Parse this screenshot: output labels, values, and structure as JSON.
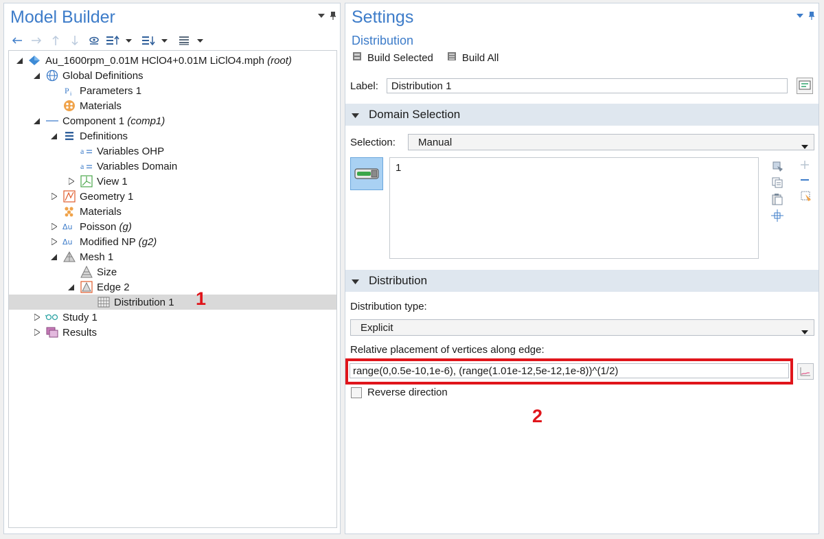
{
  "model_builder": {
    "title": "Model Builder",
    "tree": [
      {
        "label": "Au_1600rpm_0.01M HClO4+0.01M LiClO4.mph",
        "tag": "(root)",
        "icon": "model-file-icon"
      },
      {
        "label": "Global Definitions",
        "tag": "",
        "icon": "globe-icon"
      },
      {
        "label": "Parameters 1",
        "tag": "",
        "icon": "parameters-icon"
      },
      {
        "label": "Materials",
        "tag": "",
        "icon": "materials-icon"
      },
      {
        "label": "Component 1",
        "tag": "(comp1)",
        "icon": "component-icon"
      },
      {
        "label": "Definitions",
        "tag": "",
        "icon": "definitions-icon"
      },
      {
        "label": "Variables OHP",
        "tag": "",
        "icon": "variables-icon"
      },
      {
        "label": "Variables Domain",
        "tag": "",
        "icon": "variables-icon"
      },
      {
        "label": "View 1",
        "tag": "",
        "icon": "view-icon"
      },
      {
        "label": "Geometry 1",
        "tag": "",
        "icon": "geometry-icon"
      },
      {
        "label": "Materials",
        "tag": "",
        "icon": "materials-icon"
      },
      {
        "label": "Poisson",
        "tag": "(g)",
        "icon": "physics-icon"
      },
      {
        "label": "Modified NP",
        "tag": "(g2)",
        "icon": "physics-icon"
      },
      {
        "label": "Mesh 1",
        "tag": "",
        "icon": "mesh-icon"
      },
      {
        "label": "Size",
        "tag": "",
        "icon": "size-icon"
      },
      {
        "label": "Edge 2",
        "tag": "",
        "icon": "edge-icon"
      },
      {
        "label": "Distribution 1",
        "tag": "",
        "icon": "distribution-icon"
      },
      {
        "label": "Study 1",
        "tag": "",
        "icon": "study-icon"
      },
      {
        "label": "Results",
        "tag": "",
        "icon": "results-icon"
      }
    ],
    "annotation": "1"
  },
  "settings": {
    "title": "Settings",
    "subtitle": "Distribution",
    "build_selected": "Build Selected",
    "build_all": "Build All",
    "label_key": "Label:",
    "label_value": "Distribution 1",
    "domain_section": "Domain Selection",
    "selection_key": "Selection:",
    "selection_value": "Manual",
    "selection_list": [
      "1"
    ],
    "distribution_section": "Distribution",
    "distribution_type_key": "Distribution type:",
    "distribution_type_value": "Explicit",
    "vertices_key": "Relative placement of vertices along edge:",
    "vertices_value": "range(0,0.5e-10,1e-6), (range(1.01e-12,5e-12,1e-8))^(1/2)",
    "reverse_direction": "Reverse direction",
    "reverse_checked": false,
    "annotation": "2"
  },
  "colors": {
    "accent": "#3d7cc9",
    "annotation_red": "#e0151b",
    "section_bg": "#dfe7ef",
    "selected_row": "#d9d9d9"
  }
}
